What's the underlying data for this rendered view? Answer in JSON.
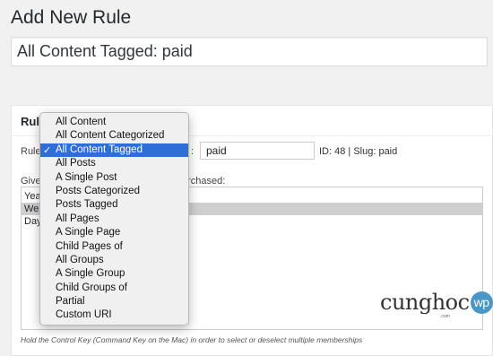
{
  "header": {
    "title": "Add New Rule"
  },
  "rule_title_value": "All Content Tagged: paid",
  "rule_box": {
    "title_partial": "Rule",
    "rule_label_partial": "Rule",
    "value_label_partial": ":",
    "value": "paid",
    "id_slug": "ID: 48 | Slug: paid",
    "give_label_partial": "Give",
    "purchased_label_partial": "urchased:",
    "access_options": [
      "Yea",
      "We",
      "Day"
    ],
    "selected_access_index": 1,
    "hint": "Hold the Control Key (Command Key on the Mac) in order to select or deselect multiple memberships"
  },
  "rule_type_dropdown": {
    "options": [
      "All Content",
      "All Content Categorized",
      "All Content Tagged",
      "All Posts",
      "A Single Post",
      "Posts Categorized",
      "Posts Tagged",
      "All Pages",
      "A Single Page",
      "Child Pages of",
      "All Groups",
      "A Single Group",
      "Child Groups of",
      "Partial",
      "Custom URI"
    ],
    "selected_index": 2,
    "check_glyph": "✓",
    "highlight_color": "#2f6ed8"
  },
  "watermark": {
    "brand_text": "cunghoc",
    "badge_text": "wp",
    "subtext": ".com"
  }
}
